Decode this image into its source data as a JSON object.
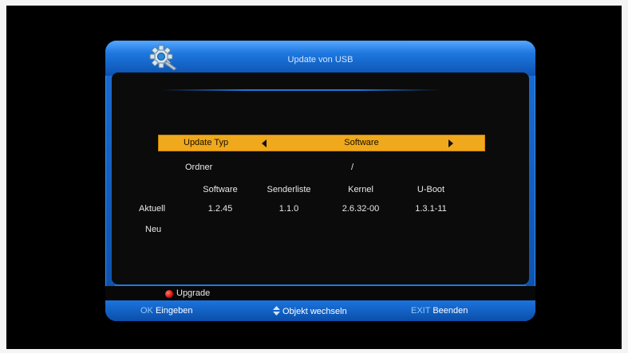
{
  "dialog": {
    "title": "Update von USB"
  },
  "update_type": {
    "label": "Update Typ",
    "value": "Software"
  },
  "folder": {
    "label": "Ordner",
    "value": "/"
  },
  "version_table": {
    "columns": [
      "Software",
      "Senderliste",
      "Kernel",
      "U-Boot"
    ],
    "rows": [
      {
        "label": "Aktuell",
        "values": [
          "1.2.45",
          "1.1.0",
          "2.6.32-00",
          "1.3.1-11"
        ]
      },
      {
        "label": "Neu",
        "values": [
          "",
          "",
          "",
          ""
        ]
      }
    ]
  },
  "color_buttons": {
    "red_label": "Upgrade"
  },
  "footer": {
    "ok_key": "OK",
    "ok_action": "Eingeben",
    "nav_action": "Objekt wechseln",
    "exit_key": "EXIT",
    "exit_action": "Beenden"
  },
  "colors": {
    "accent_blue": "#1e78e0",
    "highlight_orange": "#f0a81c",
    "red_button": "#d01010"
  },
  "icons": {
    "title_icon": "gear-icon",
    "nav_icon": "up-down-arrows-icon"
  }
}
